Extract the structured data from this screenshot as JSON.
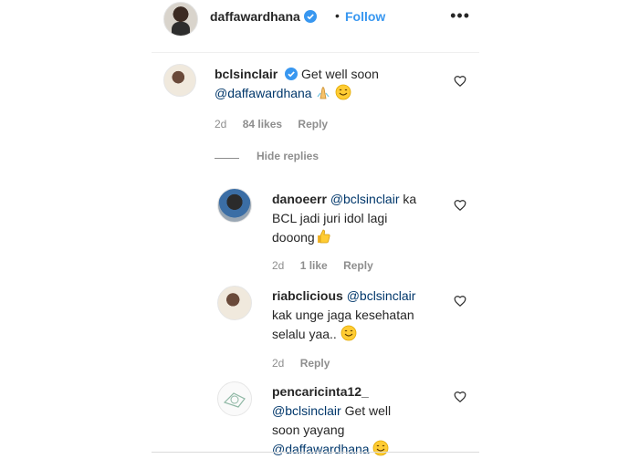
{
  "header": {
    "username": "daffawardhana",
    "separator": "•",
    "follow_label": "Follow",
    "more_label": "•••"
  },
  "comments": [
    {
      "username": "bclsinclair",
      "verified": true,
      "text": "Get well soon",
      "mention": "@daffawardhana",
      "emojis": [
        "folded-hands-emoji",
        "smiling-face-emoji"
      ],
      "time": "2d",
      "likes": "84 likes",
      "reply_label": "Reply"
    }
  ],
  "hide_replies_label": "Hide replies",
  "replies": [
    {
      "username": "danoeerr",
      "mention": "@bclsinclair",
      "text_line1": "ka",
      "text_line2": "BCL jadi juri idol lagi",
      "text_line3": "dooong",
      "emoji": "thumbs-up-emoji",
      "time": "2d",
      "likes": "1 like",
      "reply_label": "Reply"
    },
    {
      "username": "riabclicious",
      "mention": "@bclsinclair",
      "text_line1": "kak unge jaga kesehatan",
      "text_line2": "selalu yaa..",
      "emoji": "smiling-face-emoji",
      "time": "2d",
      "reply_label": "Reply"
    },
    {
      "username": "pencaricinta12_",
      "mention": "@bclsinclair",
      "text_line1": "Get well",
      "text_line2": "soon yayang",
      "mention2": "@daffawardhana",
      "emoji": "smiling-face-emoji"
    }
  ],
  "colors": {
    "accent": "#3897f0",
    "mention": "#00376b",
    "meta": "#8e8e8e",
    "text": "#262626"
  }
}
